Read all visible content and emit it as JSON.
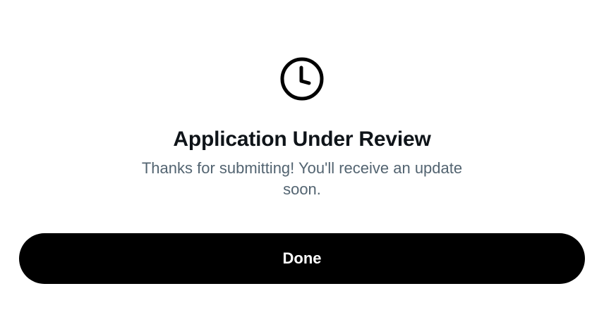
{
  "dialog": {
    "icon": "clock-icon",
    "title": "Application Under Review",
    "message": "Thanks for submitting! You'll receive an update soon.",
    "done_label": "Done"
  },
  "colors": {
    "title": "#0f1419",
    "message": "#536471",
    "button_background": "#000000",
    "button_text": "#ffffff",
    "background": "#ffffff"
  }
}
